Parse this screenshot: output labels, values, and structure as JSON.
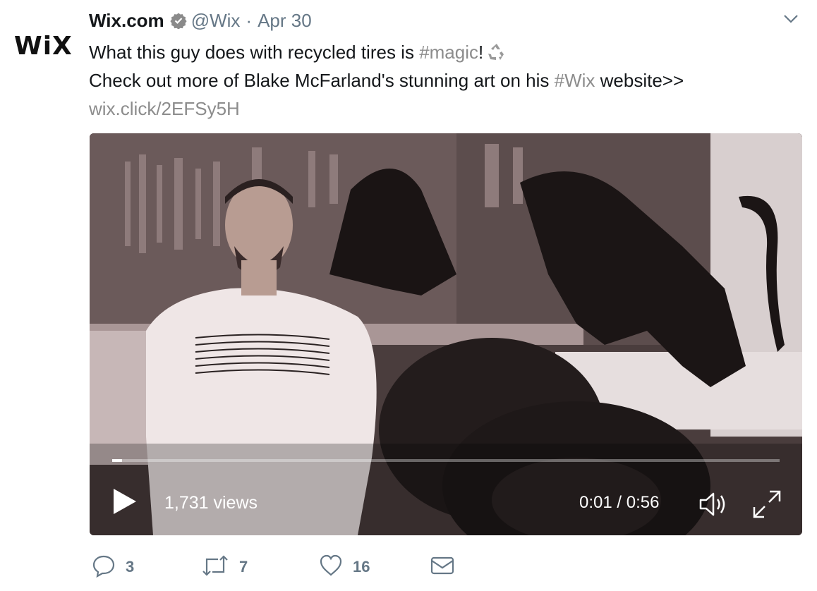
{
  "tweet": {
    "avatar_text": "WiX",
    "author_name": "Wix.com",
    "handle": "@Wix",
    "separator": "·",
    "date": "Apr 30",
    "line1_text": "What this guy does with recycled tires is ",
    "line1_hashtag": "#magic",
    "line1_after": "!",
    "line2_text": "Check out more of Blake McFarland's stunning art on his ",
    "line2_hashtag": "#Wix",
    "line2_after": " website>>",
    "link": "wix.click/2EFSy5H"
  },
  "video": {
    "views": "1,731 views",
    "timecode": "0:01 / 0:56",
    "progress": 0.015
  },
  "actions": {
    "replies": "3",
    "retweets": "7",
    "likes": "16"
  },
  "colors": {
    "secondary_text": "#657786",
    "link_text": "#8c8c8c",
    "verified": "#8a8a8a"
  },
  "icons": [
    "verified-icon",
    "caret-down-icon",
    "recycle-icon",
    "play-icon",
    "volume-icon",
    "fullscreen-icon",
    "reply-icon",
    "retweet-icon",
    "like-icon",
    "dm-icon"
  ]
}
